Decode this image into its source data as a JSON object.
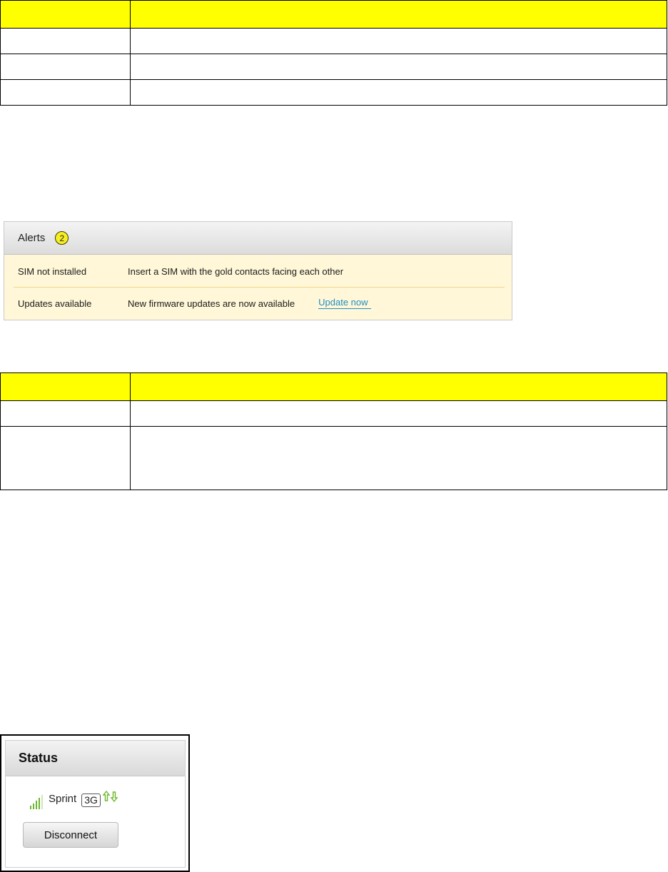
{
  "alerts": {
    "title": "Alerts",
    "count": "2",
    "items": [
      {
        "name": "SIM not installed",
        "message": "Insert a SIM with the gold contacts facing each other",
        "action": ""
      },
      {
        "name": "Updates available",
        "message": "New firmware updates are now available",
        "action": "Update now"
      }
    ],
    "colors": {
      "background": "#fff7d8",
      "badge": "#f7ef21",
      "link": "#1f8dc4"
    }
  },
  "status": {
    "title": "Status",
    "carrier": "Sprint",
    "network": "3G",
    "disconnect_label": "Disconnect",
    "signal_icon": "signal-bars-icon",
    "data_icon": "data-up-down-arrows-icon",
    "colors": {
      "signal": "#6bb82a"
    }
  },
  "tables": {
    "header_color": "#ffff00"
  }
}
